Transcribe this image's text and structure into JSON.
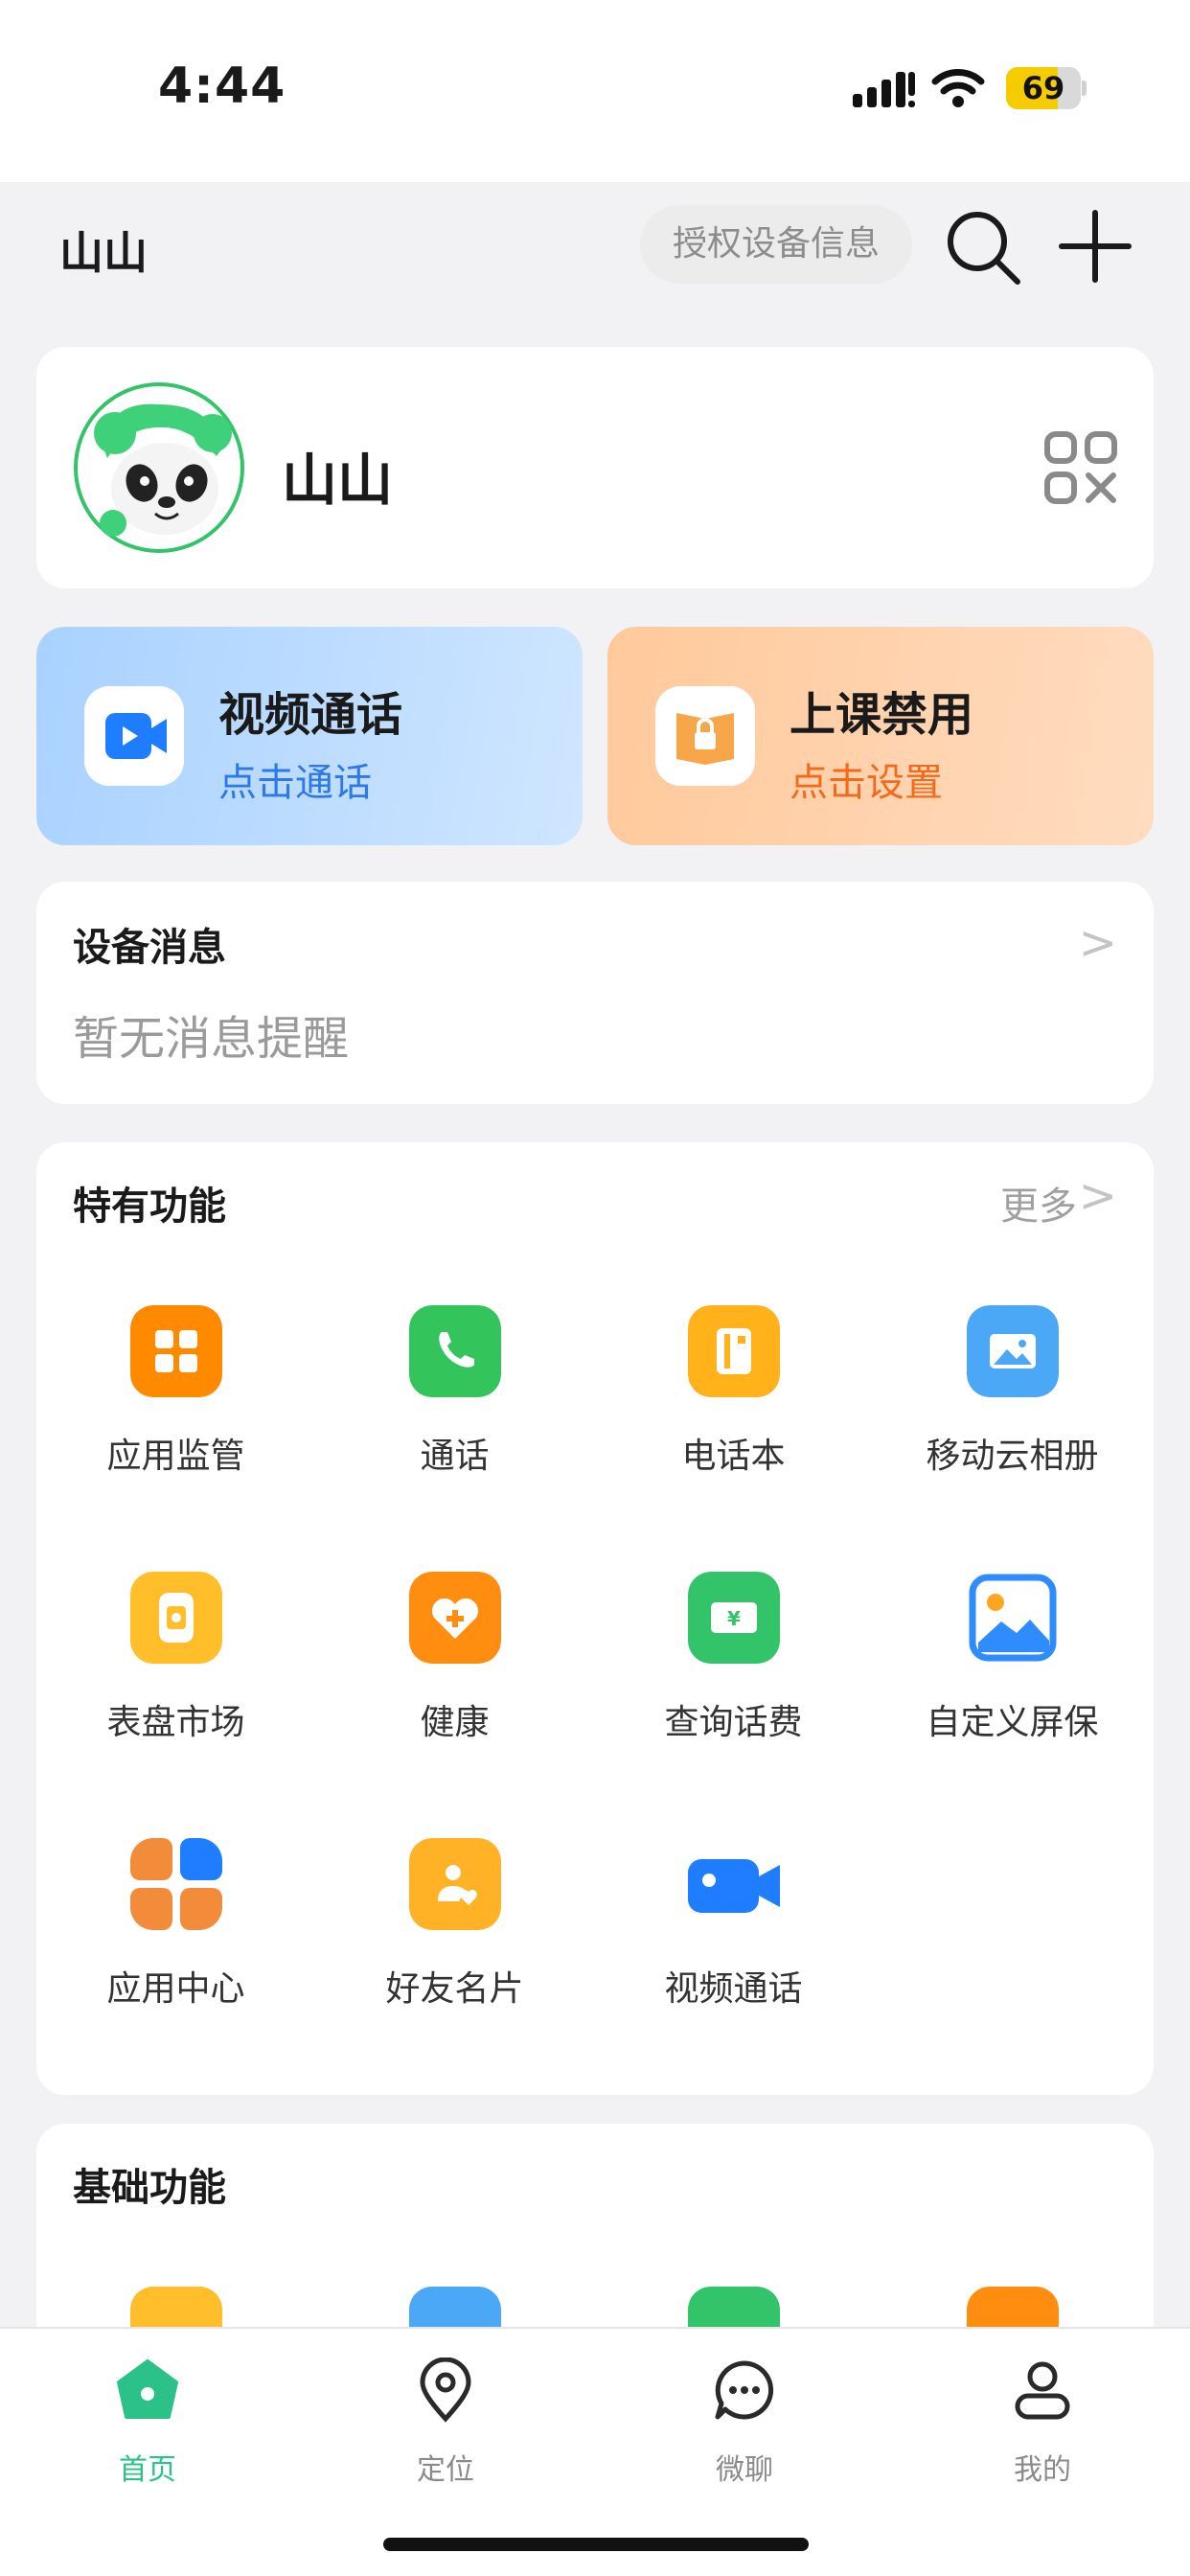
{
  "status": {
    "time": "4:44",
    "battery": "69",
    "battery_level": 0.69
  },
  "header": {
    "name": "山山",
    "auth_button": "授权设备信息",
    "search_icon": "search-icon",
    "add_icon": "plus-icon"
  },
  "profile": {
    "name": "山山",
    "avatar_icon": "panda-avatar-icon",
    "qr_icon": "qr-code-icon"
  },
  "actions": [
    {
      "title": "视频通话",
      "subtitle": "点击通话",
      "icon": "video-call-icon",
      "subtitle_color": "#2d79e6"
    },
    {
      "title": "上课禁用",
      "subtitle": "点击设置",
      "icon": "class-lock-icon",
      "subtitle_color": "#f26a1b"
    }
  ],
  "device_messages": {
    "title": "设备消息",
    "empty_text": "暂无消息提醒",
    "chevron": ">"
  },
  "features": {
    "title": "特有功能",
    "more": "更多",
    "chevron": ">",
    "items": [
      {
        "label": "应用监管",
        "icon": "app-supervision-icon",
        "color": "#ff8a00"
      },
      {
        "label": "通话",
        "icon": "phone-icon",
        "color": "#33c45c"
      },
      {
        "label": "电话本",
        "icon": "phonebook-icon",
        "color": "#ffb21a"
      },
      {
        "label": "移动云相册",
        "icon": "cloud-album-icon",
        "color": "#4ba8f7"
      },
      {
        "label": "表盘市场",
        "icon": "watch-face-market-icon",
        "color": "#ffbe2a"
      },
      {
        "label": "健康",
        "icon": "health-heart-icon",
        "color": "#ff8d10"
      },
      {
        "label": "查询话费",
        "icon": "billing-query-icon",
        "color": "#33c46a"
      },
      {
        "label": "自定义屏保",
        "icon": "custom-screensaver-icon",
        "color": "#2f8cff"
      },
      {
        "label": "应用中心",
        "icon": "app-center-icon",
        "color": "#f28c3a"
      },
      {
        "label": "好友名片",
        "icon": "friend-card-icon",
        "color": "#ffb225"
      },
      {
        "label": "视频通话",
        "icon": "video-camera-icon",
        "color": "#1f7dff"
      }
    ]
  },
  "basic": {
    "title": "基础功能"
  },
  "tabs": [
    {
      "label": "首页",
      "icon": "home-icon",
      "active": true
    },
    {
      "label": "定位",
      "icon": "location-pin-icon",
      "active": false
    },
    {
      "label": "微聊",
      "icon": "chat-bubble-icon",
      "active": false
    },
    {
      "label": "我的",
      "icon": "profile-icon",
      "active": false
    }
  ],
  "colors": {
    "accent_green": "#2cc189",
    "background": "#f2f2f4"
  }
}
